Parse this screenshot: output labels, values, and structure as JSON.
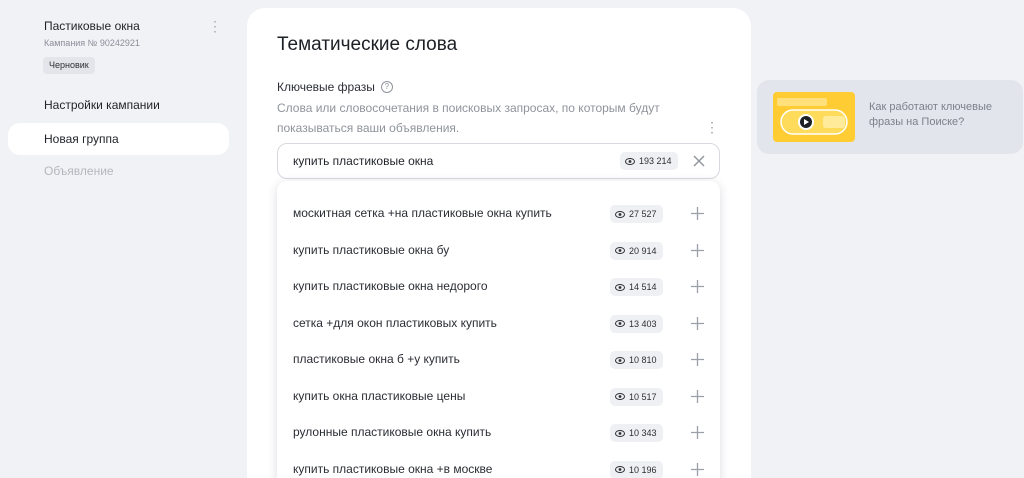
{
  "sidebar": {
    "campaign_title": "Пастиковые окна",
    "campaign_sub": "Кампания № 90242921",
    "status_badge": "Черновик",
    "items": [
      {
        "label": "Настройки кампании"
      },
      {
        "label": "Новая группа"
      },
      {
        "label": "Объявление"
      }
    ]
  },
  "main": {
    "title": "Тематические слова",
    "keywords_label": "Ключевые фразы",
    "keywords_hint": "Слова или словосочетания в поисковых запросах, по которым будут показываться ваши объявления.",
    "search": {
      "value": "купить пластиковые окна",
      "count": "193 214"
    },
    "suggestions": [
      {
        "text": "москитная сетка +на пластиковые окна купить",
        "count": "27 527"
      },
      {
        "text": "купить пластиковые окна бу",
        "count": "20 914"
      },
      {
        "text": "купить пластиковые окна недорого",
        "count": "14 514"
      },
      {
        "text": "сетка +для окон пластиковых купить",
        "count": "13 403"
      },
      {
        "text": "пластиковые окна б +у купить",
        "count": "10 810"
      },
      {
        "text": "купить окна пластиковые цены",
        "count": "10 517"
      },
      {
        "text": "рулонные пластиковые окна купить",
        "count": "10 343"
      },
      {
        "text": "купить пластиковые окна +в москве",
        "count": "10 196"
      }
    ]
  },
  "promo": {
    "text": "Как работают ключевые фразы на Поиске?"
  },
  "colors": {
    "background": "#f1f2f6",
    "promo_yellow": "#ffcc33",
    "text_muted": "#8f939b"
  }
}
